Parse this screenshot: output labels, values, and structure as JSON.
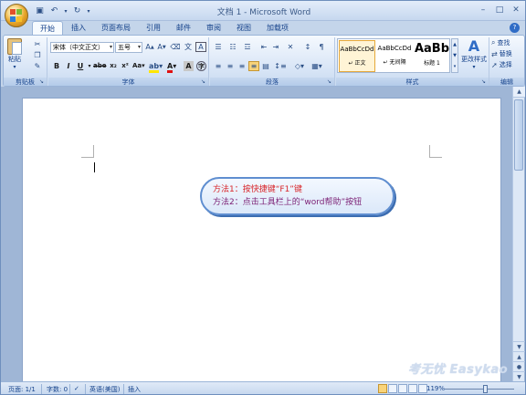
{
  "window": {
    "title": "文档 1 - Microsoft Word"
  },
  "tabs": [
    {
      "label": "开始",
      "active": true
    },
    {
      "label": "插入"
    },
    {
      "label": "页面布局"
    },
    {
      "label": "引用"
    },
    {
      "label": "邮件"
    },
    {
      "label": "审阅"
    },
    {
      "label": "视图"
    },
    {
      "label": "加载项"
    }
  ],
  "ribbon": {
    "clipboard": {
      "label": "剪贴板",
      "paste": "粘贴"
    },
    "font": {
      "label": "字体",
      "family": "宋体（中文正文）",
      "size": "五号"
    },
    "paragraph": {
      "label": "段落"
    },
    "styles": {
      "label": "样式",
      "items": [
        {
          "sample": "AaBbCcDd",
          "name": "↵ 正文"
        },
        {
          "sample": "AaBbCcDd",
          "name": "↵ 无间隔"
        },
        {
          "sample": "AaBb",
          "name": "标题 1"
        }
      ],
      "change_styles": "更改样式"
    },
    "editing": {
      "label": "编辑",
      "find": "查找",
      "replace": "替换",
      "select": "选择"
    }
  },
  "callout": {
    "line1": "方法1：按快捷键“F1”键",
    "line2": "方法2：点击工具栏上的“word帮助”按钮"
  },
  "watermark": "考无忧 Easykao",
  "status": {
    "page": "页面: 1/1",
    "words": "字数: 0",
    "language": "英语(美国)",
    "mode": "插入",
    "zoom": "119%"
  },
  "colors": {
    "accent": "#15428b",
    "callout_line1": "#d8262a",
    "callout_line2": "#7b1f74"
  }
}
